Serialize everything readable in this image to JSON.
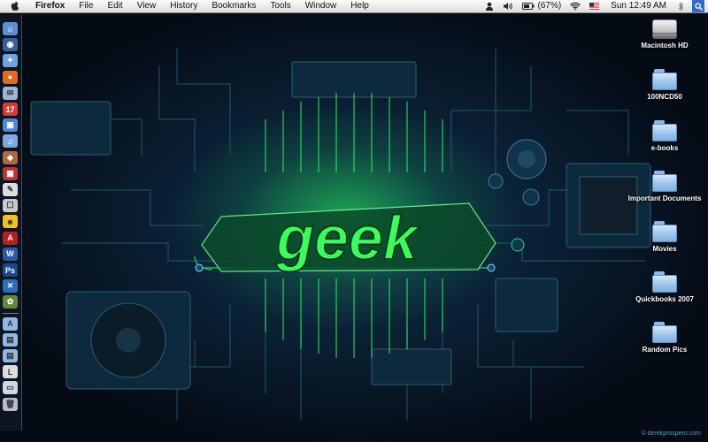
{
  "menubar": {
    "app_name": "Firefox",
    "items": [
      "File",
      "Edit",
      "View",
      "History",
      "Bookmarks",
      "Tools",
      "Window",
      "Help"
    ],
    "battery_text": "(67%)",
    "clock": "Sun 12:49 AM"
  },
  "wallpaper": {
    "logo_text": "geek",
    "watermark": "© derekprospero.com",
    "glow_color": "#39ff5a"
  },
  "desktop_icons": [
    {
      "label": "Macintosh HD",
      "kind": "harddrive"
    },
    {
      "label": "100NCD50",
      "kind": "folder"
    },
    {
      "label": "e-books",
      "kind": "folder"
    },
    {
      "label": "Important Documents",
      "kind": "folder"
    },
    {
      "label": "Movies",
      "kind": "folder"
    },
    {
      "label": "Quickbooks 2007",
      "kind": "folder"
    },
    {
      "label": "Random Pics",
      "kind": "folder"
    }
  ],
  "dock": {
    "items": [
      {
        "name": "finder-icon",
        "color": "#5b8ed6",
        "glyph": "☺"
      },
      {
        "name": "dashboard-icon",
        "color": "#3a5e9a",
        "glyph": "◉"
      },
      {
        "name": "safari-icon",
        "color": "#6aa5e8",
        "glyph": "✦"
      },
      {
        "name": "firefox-icon",
        "color": "#e46a1c",
        "glyph": "●"
      },
      {
        "name": "mail-icon",
        "color": "#9bb7d8",
        "glyph": "✉"
      },
      {
        "name": "ical-icon",
        "color": "#d93a32",
        "glyph": "17"
      },
      {
        "name": "iphoto-icon",
        "color": "#4c8bd4",
        "glyph": "▣"
      },
      {
        "name": "itunes-icon",
        "color": "#7fa8e2",
        "glyph": "♫"
      },
      {
        "name": "image-capture-icon",
        "color": "#b06a3a",
        "glyph": "◆"
      },
      {
        "name": "photo-browser-icon",
        "color": "#c23030",
        "glyph": "▦"
      },
      {
        "name": "text-editor-icon",
        "color": "#dddddd",
        "glyph": "✎"
      },
      {
        "name": "script-editor-icon",
        "color": "#c9c9c9",
        "glyph": "☐"
      },
      {
        "name": "adium-icon",
        "color": "#f2c11c",
        "glyph": "☻"
      },
      {
        "name": "acrobat-icon",
        "color": "#b82020",
        "glyph": "A"
      },
      {
        "name": "word-icon",
        "color": "#2a5aa8",
        "glyph": "W"
      },
      {
        "name": "photoshop-icon",
        "color": "#1c4a86",
        "glyph": "Ps"
      },
      {
        "name": "xcode-icon",
        "color": "#2b6fc0",
        "glyph": "✕"
      },
      {
        "name": "utility-icon",
        "color": "#5f8a3a",
        "glyph": "✿"
      },
      {
        "name": "applications-stack-icon",
        "color": "#8fb8e4",
        "glyph": "A"
      },
      {
        "name": "documents-stack-icon",
        "color": "#8fb8e4",
        "glyph": "▤"
      },
      {
        "name": "downloads-stack-icon",
        "color": "#8fb8e4",
        "glyph": "▤"
      },
      {
        "name": "folder-stack-icon",
        "color": "#dcdcdc",
        "glyph": "L"
      },
      {
        "name": "network-icon",
        "color": "#cfd7e0",
        "glyph": "▭"
      },
      {
        "name": "trash-icon",
        "color": "#b8bec6",
        "glyph": "🗑"
      }
    ]
  }
}
